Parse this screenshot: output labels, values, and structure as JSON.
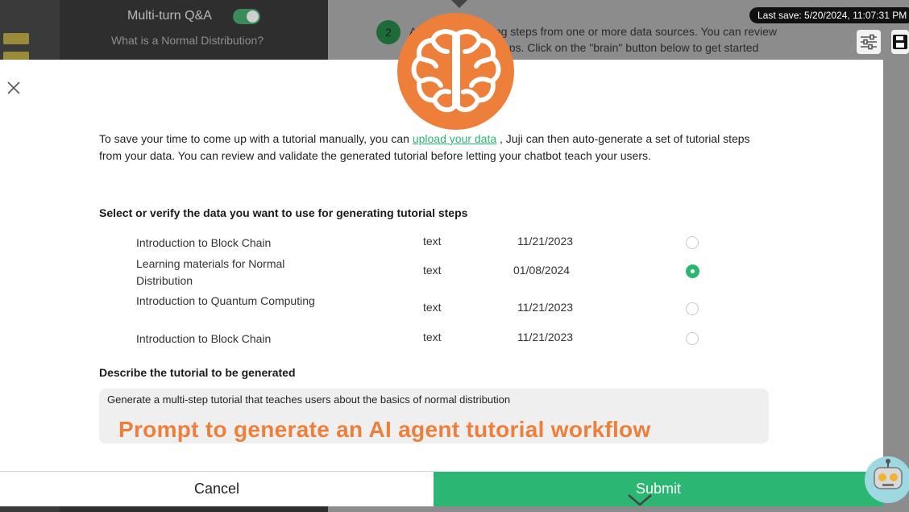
{
  "background": {
    "panel_title": "Multi-turn Q&A",
    "question": "What is a Normal Distribution?",
    "step_number": "2",
    "step_text_line1": "A                  utoring steps from one or more data sources. You can review",
    "step_text_line2": "                   ated steps. Click on the \"brain\" button below to get started",
    "last_save": "Last save: 5/20/2024, 11:07:31 PM"
  },
  "modal": {
    "intro_before_link": "To save your time to come up with a tutorial manually, you can ",
    "intro_link": "upload your data",
    "intro_after_link": " , Juji can then auto-generate a set of tutorial steps from your data. You can review and validate the generated tutorial before letting your chatbot teach your users.",
    "select_label": "Select or verify the data you want to use for generating tutorial steps",
    "data_rows": [
      {
        "name": "Introduction to Block Chain",
        "type": "text",
        "date": "11/21/2023",
        "selected": false
      },
      {
        "name": "Learning materials for Normal Distribution",
        "type": "text",
        "date": "01/08/2024",
        "selected": true
      },
      {
        "name": "Introduction to Quantum Computing",
        "type": "text",
        "date": "11/21/2023",
        "selected": false
      },
      {
        "name": "Introduction to Block Chain",
        "type": "text",
        "date": "11/21/2023",
        "selected": false
      }
    ],
    "describe_label": "Describe the tutorial to be generated",
    "describe_value": "Generate a multi-step tutorial that teaches users about the basics of normal distribution",
    "overlay_caption": "Prompt to generate an AI agent tutorial workflow",
    "cancel_label": "Cancel",
    "submit_label": "Submit"
  },
  "colors": {
    "accent": "#2bb673",
    "brain_badge": "#ee7f3b"
  },
  "icons": [
    "close-icon",
    "brain-icon",
    "settings-sliders-icon",
    "save-icon",
    "chevron-down-icon",
    "chatbot-avatar-icon"
  ]
}
